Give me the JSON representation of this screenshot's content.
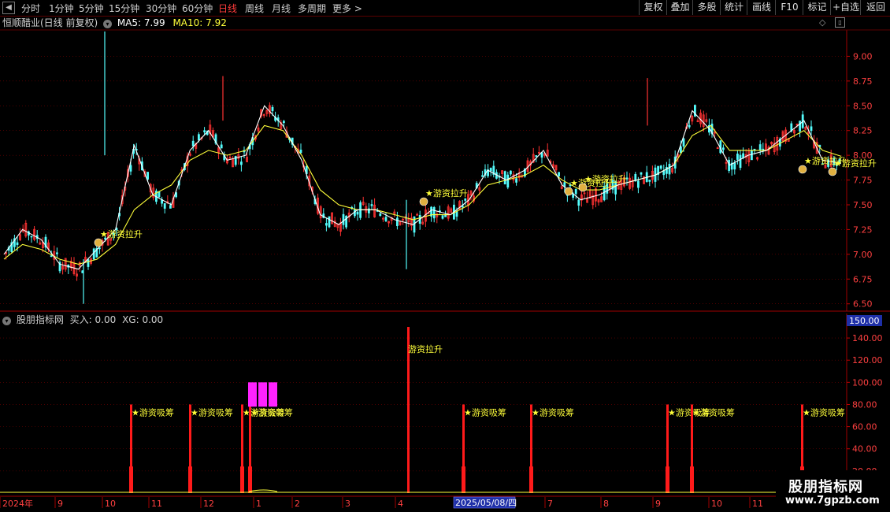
{
  "toolbar": {
    "periods": [
      {
        "label": "分时",
        "active": false
      },
      {
        "label": "1分钟",
        "active": false
      },
      {
        "label": "5分钟",
        "active": false
      },
      {
        "label": "15分钟",
        "active": false
      },
      {
        "label": "30分钟",
        "active": false
      },
      {
        "label": "60分钟",
        "active": false
      },
      {
        "label": "日线",
        "active": true
      },
      {
        "label": "周线",
        "active": false
      },
      {
        "label": "月线",
        "active": false
      },
      {
        "label": "多周期",
        "active": false
      },
      {
        "label": "更多 >",
        "active": false
      }
    ],
    "right_buttons": [
      "复权",
      "叠加",
      "多股",
      "统计",
      "画线",
      "F10",
      "标记",
      "+自选",
      "返回"
    ]
  },
  "main_chart": {
    "title": "恒顺醋业(日线 前复权)",
    "ma5_label": "MA5: 7.99",
    "ma10_label": "MA10: 7.92",
    "y_ticks": [
      "9.00",
      "8.75",
      "8.50",
      "8.25",
      "8.00",
      "7.75",
      "7.50",
      "7.25",
      "7.00",
      "6.75",
      "6.50"
    ],
    "signal_label": "游资拉升"
  },
  "indicator_panel": {
    "title": "股朋指标网",
    "buy_label": "买入: 0.00",
    "xg_label": "XG: 0.00",
    "top_value": "150.00",
    "y_ticks": [
      "140.00",
      "120.00",
      "100.00",
      "80.00",
      "60.00",
      "40.00",
      "20.00"
    ],
    "absorb_label": "游资吸筹",
    "lift_label": "游资拉升"
  },
  "x_axis": {
    "labels": [
      "2024年",
      "9",
      "10",
      "11",
      "12",
      "1",
      "2",
      "3",
      "4",
      "5",
      "6",
      "7",
      "8",
      "9",
      "10",
      "11"
    ],
    "cursor_date": "2025/05/08/四"
  },
  "watermark": {
    "line1": "股朋指标网",
    "line2": "www.7gpzb.com"
  },
  "colors": {
    "up": "#ff3232",
    "down": "#54fcfc",
    "ma5": "#ffffff",
    "ma10": "#ffff3a",
    "grid": "#7a0000",
    "signal": "#ffff3a"
  },
  "chart_data": {
    "type": "line",
    "x_range": [
      "2024-08",
      "2025-12"
    ],
    "ylim": [
      6.45,
      9.25
    ],
    "series": [
      {
        "name": "MA5",
        "values": [
          7.0,
          7.25,
          7.15,
          6.9,
          6.85,
          7.05,
          7.25,
          8.1,
          7.6,
          7.5,
          8.05,
          8.25,
          7.95,
          8.0,
          8.5,
          8.3,
          7.95,
          7.4,
          7.3,
          7.45,
          7.45,
          7.35,
          7.3,
          7.45,
          7.4,
          7.55,
          7.85,
          7.75,
          7.85,
          8.05,
          7.7,
          7.55,
          7.6,
          7.7,
          7.75,
          7.8,
          7.9,
          8.45,
          8.25,
          7.9,
          8.0,
          8.05,
          8.2,
          8.35,
          7.95,
          7.92
        ]
      },
      {
        "name": "MA10",
        "values": [
          6.95,
          7.1,
          7.05,
          6.95,
          6.9,
          6.95,
          7.1,
          7.45,
          7.6,
          7.7,
          7.95,
          8.05,
          8.0,
          8.05,
          8.3,
          8.25,
          8.0,
          7.65,
          7.5,
          7.45,
          7.45,
          7.4,
          7.35,
          7.4,
          7.4,
          7.5,
          7.7,
          7.75,
          7.8,
          7.9,
          7.75,
          7.65,
          7.65,
          7.7,
          7.75,
          7.8,
          7.9,
          8.2,
          8.3,
          8.05,
          8.05,
          8.05,
          8.15,
          8.25,
          8.05,
          7.99
        ]
      }
    ],
    "signal_bars_absorb": 80,
    "signal_bar_lift": 150
  }
}
